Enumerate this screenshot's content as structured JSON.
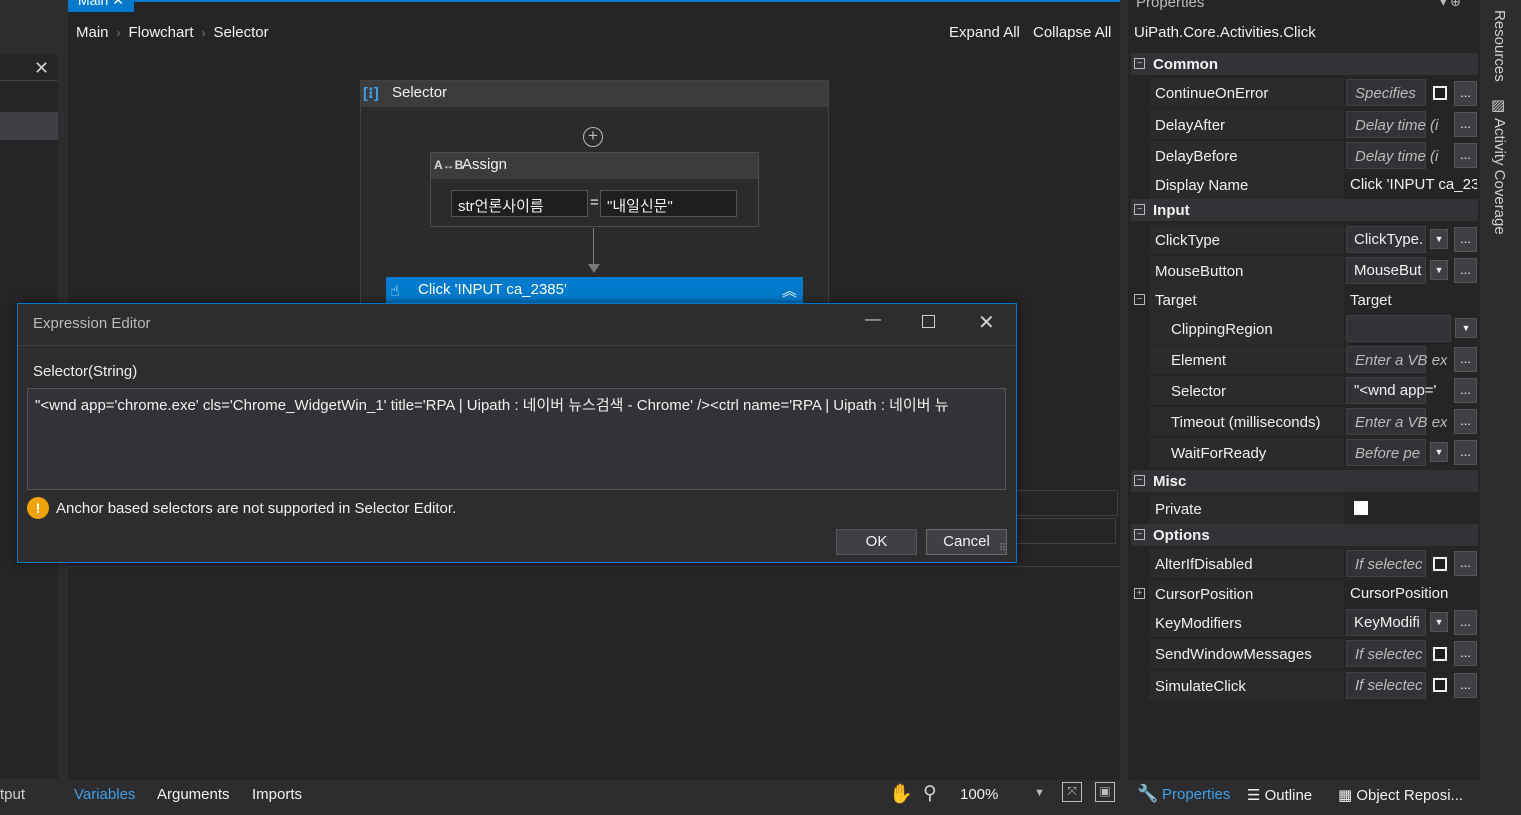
{
  "left": {
    "output_label": "tput",
    "close_glyph": "✕"
  },
  "designer": {
    "tab_label": "Main ✕",
    "breadcrumb": [
      "Main",
      "Flowchart",
      "Selector"
    ],
    "expand_all": "Expand All",
    "collapse_all": "Collapse All",
    "selector_title": "Selector",
    "assign_title": "Assign",
    "assign_to": "str언론사이름",
    "assign_value": "\"내일신문\"",
    "click_title": "Click 'INPUT  ca_2385'"
  },
  "expression_editor": {
    "title": "Expression Editor",
    "label": "Selector(String)",
    "text": "\"<wnd app='chrome.exe' cls='Chrome_WidgetWin_1' title='RPA | Uipath : 네이버 뉴스검색 - Chrome' /><ctrl name='RPA | Uipath : 네이버 뉴",
    "warning": "Anchor based selectors are not supported in Selector Editor.",
    "ok_label": "OK",
    "cancel_label": "Cancel"
  },
  "bottom_bar": {
    "tabs": [
      "Variables",
      "Arguments",
      "Imports"
    ],
    "zoom": "100%"
  },
  "properties": {
    "title": "Properties",
    "type_name": "UiPath.Core.Activities.Click",
    "categories": {
      "common": "Common",
      "input": "Input",
      "misc": "Misc",
      "options": "Options"
    },
    "rows": {
      "continue_on_error": {
        "name": "ContinueOnError",
        "value": "Specifies"
      },
      "delay_after": {
        "name": "DelayAfter",
        "value": "Delay time (i"
      },
      "delay_before": {
        "name": "DelayBefore",
        "value": "Delay time (i"
      },
      "display_name": {
        "name": "Display Name",
        "value": "Click 'INPUT  ca_23"
      },
      "click_type": {
        "name": "ClickType",
        "value": "ClickType."
      },
      "mouse_button": {
        "name": "MouseButton",
        "value": "MouseBut"
      },
      "target": {
        "name": "Target",
        "value": "Target"
      },
      "clipping_region": {
        "name": "ClippingRegion",
        "value": ""
      },
      "element": {
        "name": "Element",
        "value": "Enter a VB ex"
      },
      "selector": {
        "name": "Selector",
        "value": "\"<wnd app='"
      },
      "timeout": {
        "name": "Timeout (milliseconds)",
        "value": "Enter a VB ex"
      },
      "wait_for_ready": {
        "name": "WaitForReady",
        "value": "Before pe"
      },
      "private": {
        "name": "Private",
        "value": ""
      },
      "alter_if_disabled": {
        "name": "AlterIfDisabled",
        "value": "If selectec"
      },
      "cursor_position": {
        "name": "CursorPosition",
        "value": "CursorPosition"
      },
      "key_modifiers": {
        "name": "KeyModifiers",
        "value": "KeyModifi"
      },
      "send_window_messages": {
        "name": "SendWindowMessages",
        "value": "If selectec"
      },
      "simulate_click": {
        "name": "SimulateClick",
        "value": "If selectec"
      }
    },
    "bottom_tabs": {
      "properties": "Properties",
      "outline": "Outline",
      "object_repo": "Object Reposi..."
    }
  },
  "right_strip": {
    "resources": "Resources",
    "activity_coverage": "Activity Coverage"
  },
  "colors": {
    "accent": "#007acc",
    "warning": "#f0a30a",
    "background": "#252526"
  }
}
